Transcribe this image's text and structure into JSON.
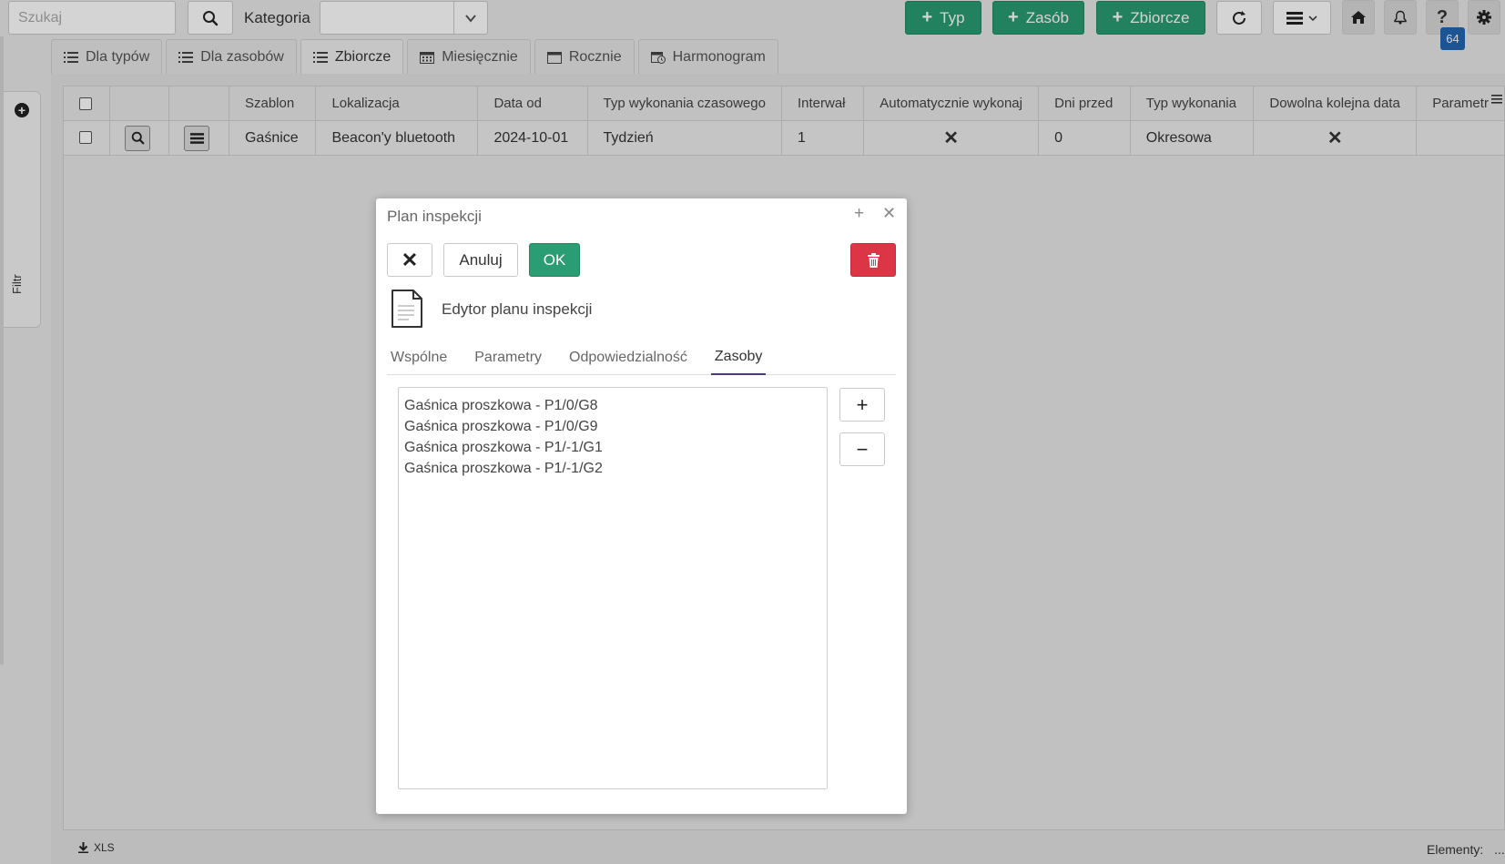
{
  "toolbar": {
    "search_placeholder": "Szukaj",
    "category_label": "Kategoria",
    "btn_typ": "Typ",
    "btn_zasob": "Zasób",
    "btn_zbiorcze": "Zbiorcze",
    "help_badge": "64"
  },
  "sidebar": {
    "filter_label": "Filtr"
  },
  "tabs": [
    {
      "label": "Dla typów",
      "icon": "list-icon"
    },
    {
      "label": "Dla zasobów",
      "icon": "list-icon"
    },
    {
      "label": "Zbiorcze",
      "icon": "list-icon",
      "active": true
    },
    {
      "label": "Miesięcznie",
      "icon": "calendar-month-icon"
    },
    {
      "label": "Rocznie",
      "icon": "calendar-icon"
    },
    {
      "label": "Harmonogram",
      "icon": "schedule-icon"
    }
  ],
  "table": {
    "headers": [
      "Szablon",
      "Lokalizacja",
      "Data od",
      "Typ wykonania czasowego",
      "Interwał",
      "Automatycznie wykonaj",
      "Dni przed",
      "Typ wykonania",
      "Dowolna kolejna data",
      "Parametr"
    ],
    "rows": [
      {
        "szablon": "Gaśnice",
        "lokalizacja": "Beacon'y bluetooth",
        "data_od": "2024-10-01",
        "typ_czasowy": "Tydzień",
        "interwal": "1",
        "auto": "✕",
        "dni_przed": "0",
        "typ_wykonania": "Okresowa",
        "dowolna": "✕",
        "parametr": ""
      }
    ]
  },
  "footer": {
    "export": "XLS",
    "elements_label": "Elementy:",
    "elements_value": "..."
  },
  "dialog": {
    "title": "Plan inspekcji",
    "cancel_label": "Anuluj",
    "ok_label": "OK",
    "heading": "Edytor planu inspekcji",
    "tabs": [
      "Wspólne",
      "Parametry",
      "Odpowiedzialność",
      "Zasoby"
    ],
    "active_tab": "Zasoby",
    "items": [
      "Gaśnica proszkowa - P1/0/G8",
      "Gaśnica proszkowa - P1/0/G9",
      "Gaśnica proszkowa - P1/-1/G1",
      "Gaśnica proszkowa - P1/-1/G2"
    ],
    "add_label": "+",
    "remove_label": "−"
  },
  "colors": {
    "green": "#2a9d74",
    "red": "#dc3545",
    "badge": "#2266b3",
    "tab_underline": "#4a3a7a"
  }
}
